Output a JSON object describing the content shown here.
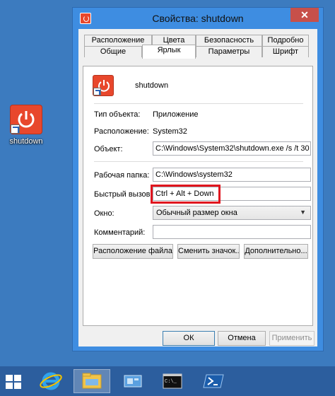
{
  "desktop": {
    "shortcut_label": "shutdown"
  },
  "window": {
    "title": "Свойства: shutdown",
    "close_glyph": "✕"
  },
  "tabs": {
    "row1": [
      "Расположение",
      "Цвета",
      "Безопасность",
      "Подробно"
    ],
    "row2": [
      "Общие",
      "Ярлык",
      "Параметры",
      "Шрифт"
    ],
    "active": "Ярлык"
  },
  "shortcut": {
    "name": "shutdown",
    "type_label": "Тип объекта:",
    "type_value": "Приложение",
    "location_label": "Расположение:",
    "location_value": "System32",
    "target_label": "Объект:",
    "target_value": "C:\\Windows\\System32\\shutdown.exe /s /t 30",
    "start_in_label": "Рабочая папка:",
    "start_in_value": "C:\\Windows\\system32",
    "hotkey_label": "Быстрый вызов:",
    "hotkey_value": "Ctrl + Alt + Down",
    "run_label": "Окно:",
    "run_value": "Обычный размер окна",
    "comment_label": "Комментарий:",
    "comment_value": "",
    "open_location_button": "Расположение файла",
    "change_icon_button": "Сменить значок...",
    "advanced_button": "Дополнительно..."
  },
  "dialog_buttons": {
    "ok": "ОК",
    "cancel": "Отмена",
    "apply": "Применить"
  },
  "taskbar": {
    "items": [
      "start-icon",
      "internet-explorer-icon",
      "file-explorer-icon",
      "control-panel-icon",
      "command-prompt-icon",
      "powershell-icon"
    ],
    "active_item": "file-explorer-icon"
  },
  "colors": {
    "desktop": "#3c7bbf",
    "window_frame": "#3e8de1",
    "highlight_box": "#e0141e",
    "app_icon": "#e8472c"
  }
}
